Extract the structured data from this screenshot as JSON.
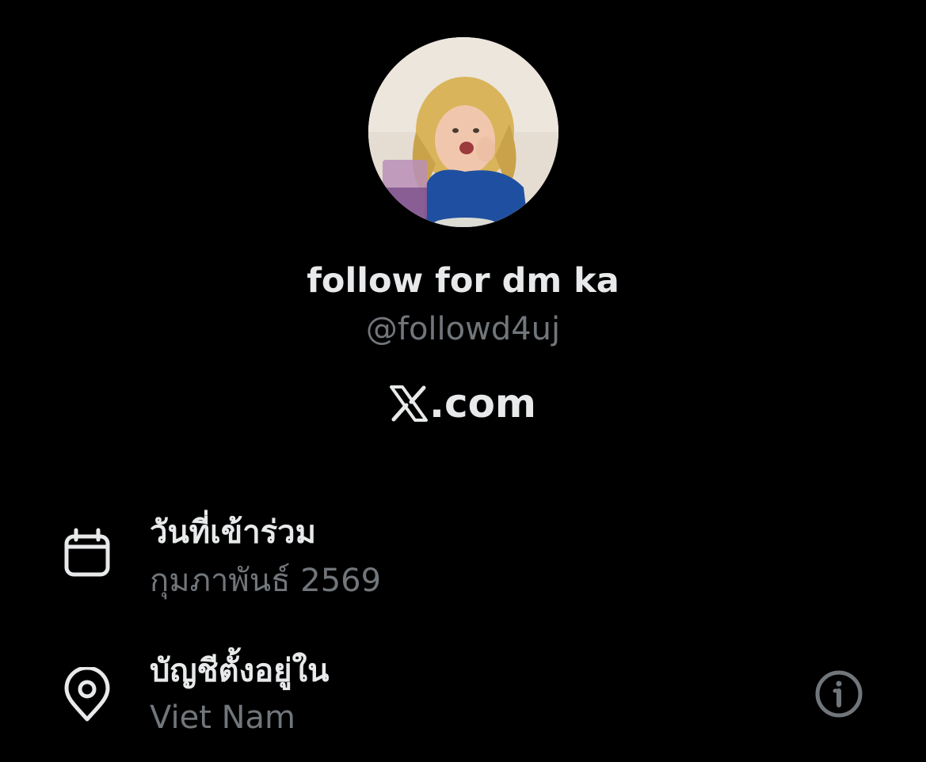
{
  "profile": {
    "display_name": "follow for dm ka",
    "handle": "@followd4uj",
    "website": ".com",
    "website_logo": "x-logo-icon"
  },
  "about": {
    "joined_label": "วันที่เข้าร่วม",
    "joined_value": "กุมภาพันธ์ 2569",
    "joined_icon": "calendar-icon",
    "location_label": "บัญชีตั้งอยู่ใน",
    "location_value": "Viet Nam",
    "location_icon": "location-pin-icon",
    "info_icon": "info-icon"
  },
  "colors": {
    "background": "#000000",
    "primary_text": "#e7e9ea",
    "secondary_text": "#71767b"
  }
}
